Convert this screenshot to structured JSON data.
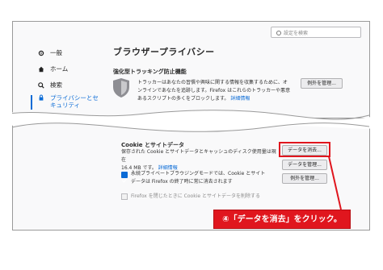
{
  "search": {
    "placeholder": "設定を検索"
  },
  "sidebar": {
    "items": [
      {
        "label": "一般",
        "icon": "gear-icon"
      },
      {
        "label": "ホーム",
        "icon": "home-icon"
      },
      {
        "label": "検索",
        "icon": "search-icon"
      },
      {
        "label_line1": "プライバシーとセ",
        "label_line2": "キュリティ",
        "icon": "lock-icon",
        "active": true
      }
    ]
  },
  "main": {
    "title": "ブラウザープライバシー",
    "tracking": {
      "heading": "強化型トラッキング防止機能",
      "desc_line1": "トラッカーはあなたの習慣や興味に関する情報を収集するために、オ",
      "desc_line2": "ンラインであなたを追跡します。Firefox はこれらのトラッカーや悪意",
      "desc_line3": "あるスクリプトの多くをブロックします。",
      "learn_more": "詳細情報",
      "manage_exceptions": "例外を管理..."
    },
    "cookies": {
      "heading": "Cookie とサイトデータ",
      "desc_line1": "保存された Cookie とサイトデータとキャッシュのディスク使用量は現在",
      "desc_line2": "16.4 MB です。",
      "learn_more": "詳細情報",
      "clear_data": "データを消去...",
      "manage_data": "データを管理...",
      "manage_exceptions": "例外を管理...",
      "private_notice_line1": "永続プライベートブラウジングモードでは、Cookie とサイト",
      "private_notice_line2": "データは Firefox の終了時に常に消去されます",
      "delete_on_close": "Firefox を閉じたときに Cookie とサイトデータを削除する"
    }
  },
  "callout": {
    "text": "④「データを消去」をクリック。"
  },
  "colors": {
    "accent": "#0a6bd6",
    "highlight": "#e0161e"
  }
}
